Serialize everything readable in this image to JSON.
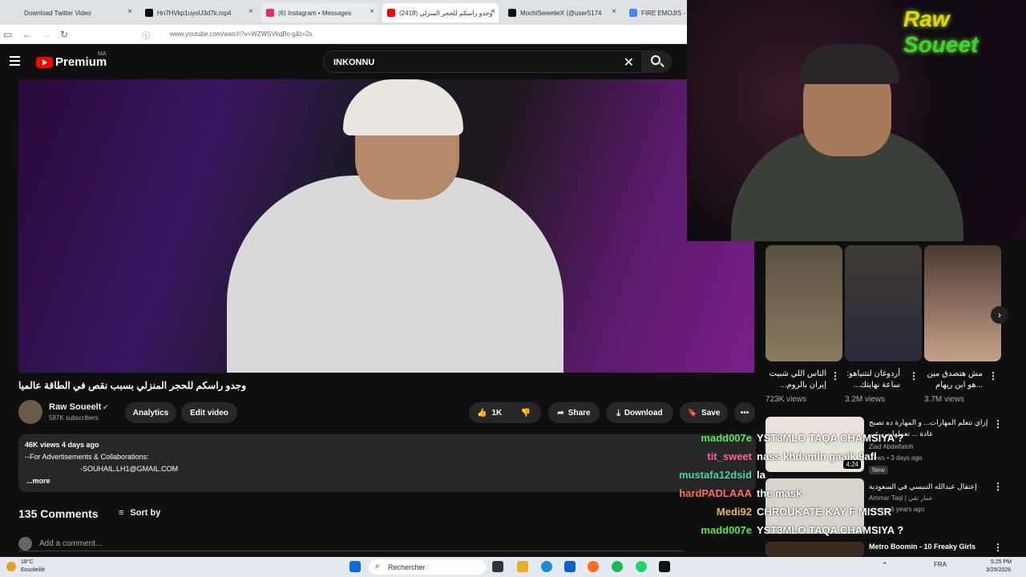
{
  "tabs": [
    {
      "label": "Download Twitter Video"
    },
    {
      "label": "Hn7HVkp1uyoU3d7k.mp4"
    },
    {
      "label": "(6) Instagram • Messages"
    },
    {
      "label": "(2418) وجدو راسكم للحجر المنزلي"
    },
    {
      "label": "MochiSweetieX (@user5174"
    },
    {
      "label": "FIRE EMOJIS - "
    }
  ],
  "address": {
    "url": "www.youtube.com/watch?v=WZWSVkqBc-g&t=2s"
  },
  "header": {
    "premium": "Premium",
    "region": "MA",
    "search": "INKONNU"
  },
  "video": {
    "title": "وجدو راسكم للحجر المنزلي بسبب نقص في الطاقة عالميا",
    "channel": "Raw Soueelt",
    "subs": "587K subscribers",
    "analytics": "Analytics",
    "edit": "Edit video",
    "likes": "1K",
    "share": "Share",
    "download": "Download",
    "save": "Save",
    "meta": "46K views  4 days ago",
    "desc1": "--For Advertisements & Collaborations:",
    "desc2": "-SOUHAIL.LH1@GMAIL.COM",
    "more": "...more",
    "comments": "135 Comments",
    "sort": "Sort by",
    "add": "Add a comment..."
  },
  "overlay": {
    "brand1": "Raw ",
    "brand2": "Soueet"
  },
  "shorts": [
    {
      "title": "الناس اللي شبيت إيران بالروم...",
      "views": "723K views"
    },
    {
      "title": "أردوغان لنتنياهو: ساعة نهايتك...",
      "views": "3.2M views"
    },
    {
      "title": "مش هتصدق مين ...هو ابن ريهام",
      "views": "3.7M views"
    }
  ],
  "related": [
    {
      "title": "إزاي تتعلم المهارات... و المهارة ده تصبح",
      "title2": "عادة ... تعملها من غير",
      "channel": "Ziad Abdelfatoh",
      "meta": "views • 3 days ago",
      "badge": "New",
      "dur": "4:24"
    },
    {
      "title": "إعتقال عبدالله التنيسي في السعودية",
      "channel": "Ammar Taqi | عمار تقي",
      "meta": "views • 6 years ago"
    },
    {
      "title": "Metro Boomin - 10 Freaky Girls"
    }
  ],
  "chat": [
    {
      "user": "madd007e",
      "msg": "YST3MLO TAQA CHAMSIYA ?",
      "color": "#5fe05f"
    },
    {
      "user": "tit_sweet",
      "msg": "nass khdamin gaaik 9afl",
      "color": "#ff5fa0"
    },
    {
      "user": "mustafa12dsid",
      "msg": "la",
      "color": "#4fd0a0"
    },
    {
      "user": "hardPADLAAA",
      "msg": "the mask",
      "color": "#ff6b6b"
    },
    {
      "user": "Medi92",
      "msg": "CHROUKATE KAY F MISSR",
      "color": "#e8b84a"
    },
    {
      "user": "madd007e",
      "msg": "YST3MLO TAQA CHAMSIYA ?",
      "color": "#5fe05f"
    }
  ],
  "taskbar": {
    "temp": "18°C",
    "weather": "Ensoleillé",
    "search": "Rechercher",
    "lang": "FRA",
    "time": "5:25 PM",
    "date": "3/29/2026"
  }
}
